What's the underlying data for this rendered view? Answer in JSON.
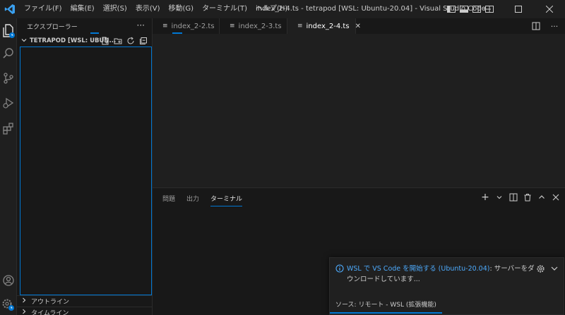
{
  "titlebar": {
    "menus": [
      "ファイル(F)",
      "編集(E)",
      "選択(S)",
      "表示(V)",
      "移動(G)",
      "ターミナル(T)",
      "ヘルプ(H)"
    ],
    "title": "index_2-4.ts - tetrapod [WSL: Ubuntu-20.04] - Visual Studio Code"
  },
  "sidebar": {
    "header": "エクスプローラー",
    "more": "···",
    "section_title": "TETRAPOD [WSL: UBUN...",
    "bottom_sections": [
      "アウトライン",
      "タイムライン"
    ]
  },
  "tabs": [
    {
      "label": "index_2-2.ts",
      "active": false
    },
    {
      "label": "index_2-3.ts",
      "active": false
    },
    {
      "label": "index_2-4.ts",
      "active": true
    }
  ],
  "panel": {
    "tabs": [
      "問題",
      "出力",
      "ターミナル"
    ],
    "active_tab": "ターミナル"
  },
  "notification": {
    "link_text": "WSL で VS Code を開始する (Ubuntu-20.04)",
    "message": ": サーバーをダウンロードしています...",
    "source": "ソース: リモート - WSL (拡張機能)"
  },
  "colors": {
    "accent": "#0078d4",
    "link": "#4daafc",
    "background": "#1f1f1f",
    "sidebar": "#181818"
  }
}
